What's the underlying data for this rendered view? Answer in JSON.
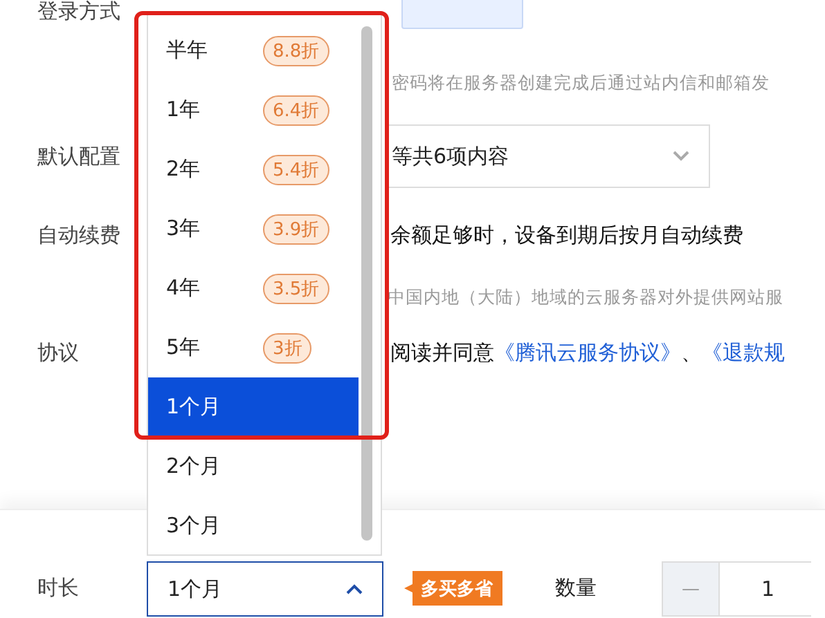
{
  "form": {
    "login": {
      "label": "登录方式"
    },
    "password_hint": "密码将在服务器创建完成后通过站内信和邮箱发",
    "default_config": {
      "label": "默认配置",
      "value": "等共6项内容"
    },
    "auto_renew": {
      "label": "自动续费",
      "text": "余额足够时，设备到期后按月自动续费"
    },
    "icp_hint": "中国内地（大陆）地域的云服务器对外提供网站服",
    "agreement": {
      "label": "协议",
      "text": "阅读并同意",
      "links": [
        "《腾讯云服务协议》",
        "《退款规"
      ],
      "separator": "、"
    }
  },
  "duration_menu": {
    "options": [
      {
        "label": "半年",
        "discount": "8.8折",
        "selected": false
      },
      {
        "label": "1年",
        "discount": "6.4折",
        "selected": false
      },
      {
        "label": "2年",
        "discount": "5.4折",
        "selected": false
      },
      {
        "label": "3年",
        "discount": "3.9折",
        "selected": false
      },
      {
        "label": "4年",
        "discount": "3.5折",
        "selected": false
      },
      {
        "label": "5年",
        "discount": "3折",
        "selected": false
      },
      {
        "label": "1个月",
        "selected": true
      },
      {
        "label": "2个月",
        "selected": false
      },
      {
        "label": "3个月",
        "selected": false
      }
    ]
  },
  "footer": {
    "duration": {
      "label": "时长",
      "value": "1个月",
      "expanded": true
    },
    "promo": "多买多省",
    "quantity": {
      "label": "数量",
      "decrement": "—",
      "value": "1"
    }
  }
}
